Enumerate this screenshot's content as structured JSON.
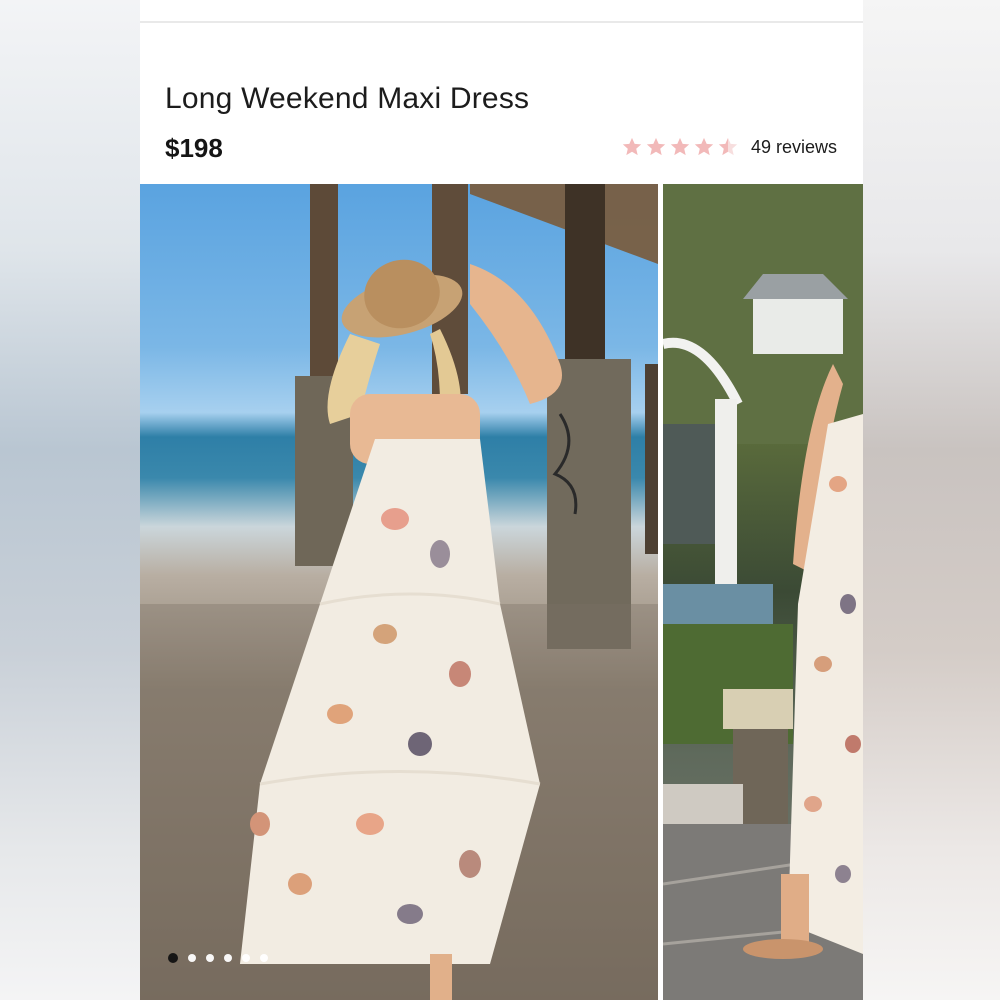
{
  "product": {
    "title": "Long Weekend Maxi Dress",
    "price": "$198",
    "rating": {
      "stars": 4.5,
      "reviews_label": "49 reviews",
      "star_color": "#f2b9b9"
    }
  },
  "gallery": {
    "dot_count": 6,
    "active_index": 0,
    "main_photo": "model-in-seashell-print-maxi-dress-on-beach",
    "side_photo": "model-in-seashell-print-maxi-dress-in-garden"
  },
  "colors": {
    "text": "#1c1c1c",
    "background": "#ffffff"
  }
}
